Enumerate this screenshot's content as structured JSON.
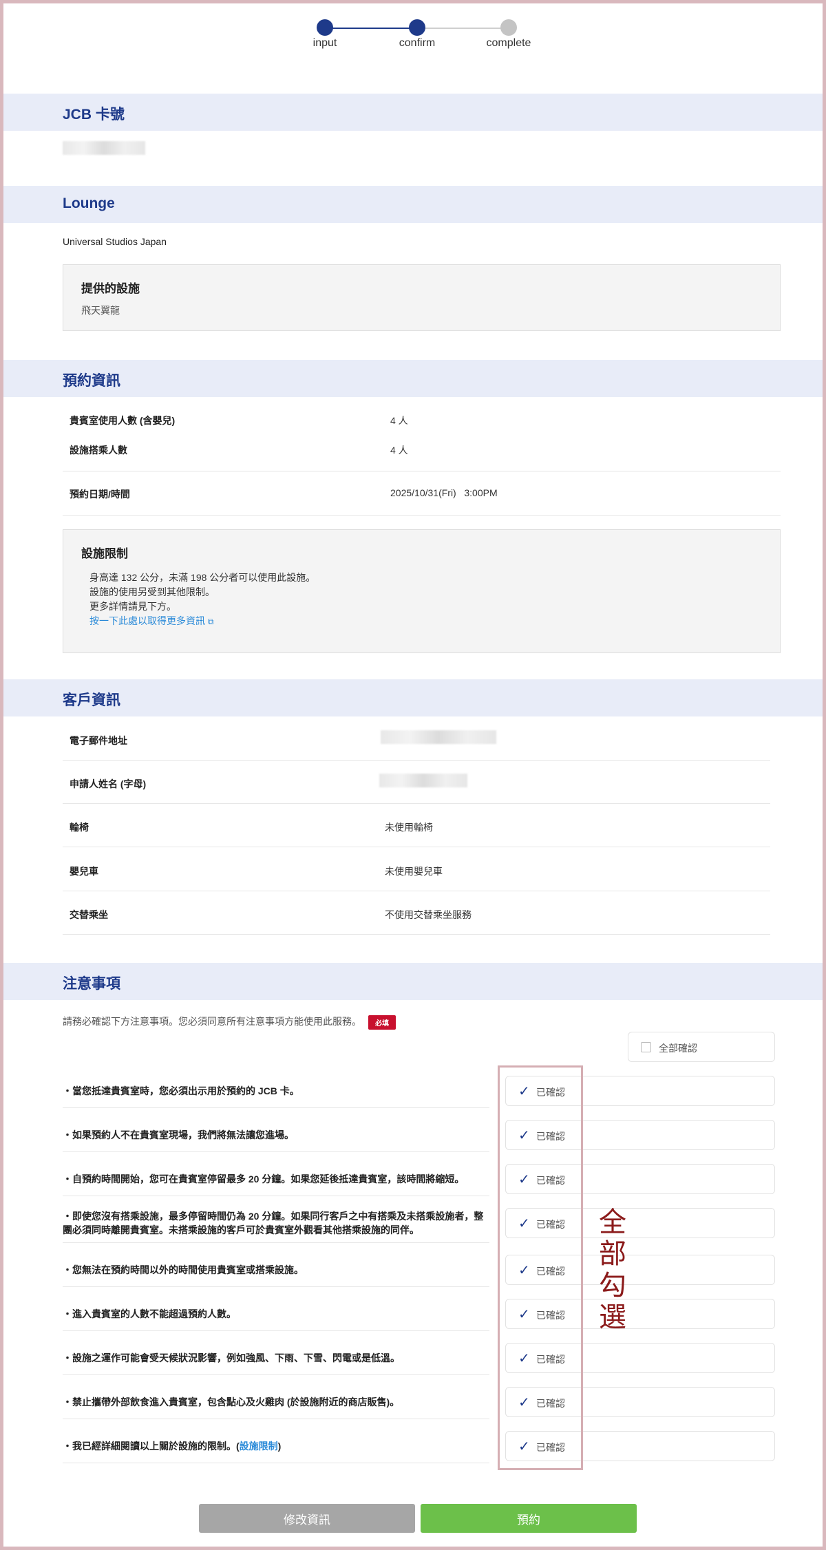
{
  "steps": [
    {
      "label": "input"
    },
    {
      "label": "confirm"
    },
    {
      "label": "complete"
    }
  ],
  "card": {
    "title": "JCB 卡號"
  },
  "lounge": {
    "title": "Lounge",
    "name": "Universal Studios Japan",
    "facility_title": "提供的設施",
    "facility": "飛天翼龍"
  },
  "reservation": {
    "title": "預約資訊",
    "rows": [
      {
        "label": "貴賓室使用人數 (含嬰兒)",
        "value": "4 人"
      },
      {
        "label": "設施搭乘人數",
        "value": "4 人"
      },
      {
        "label": "預約日期/時間",
        "value": "2025/10/31(Fri)   3:00PM"
      }
    ],
    "limit_title": "設施限制",
    "limit_lines": [
      "身高達 132 公分，未滿 198 公分者可以使用此設施。",
      "設施的使用另受到其他限制。",
      "更多詳情請見下方。"
    ],
    "limit_link": "按一下此處以取得更多資訊"
  },
  "customer": {
    "title": "客戶資訊",
    "rows": [
      {
        "label": "電子郵件地址",
        "value": ""
      },
      {
        "label": "申請人姓名 (字母)",
        "value": ""
      },
      {
        "label": "輪椅",
        "value": "未使用輪椅"
      },
      {
        "label": "嬰兒車",
        "value": "未使用嬰兒車"
      },
      {
        "label": "交替乘坐",
        "value": "不使用交替乘坐服務"
      }
    ]
  },
  "notes": {
    "title": "注意事項",
    "intro": "請務必確認下方注意事項。您必須同意所有注意事項方能使用此服務。",
    "required": "必填",
    "confirm_all": "全部確認",
    "confirmed_label": "已確認",
    "items": [
      "・當您抵達貴賓室時，您必須出示用於預約的 JCB 卡。",
      "・如果預約人不在貴賓室現場，我們將無法讓您進場。",
      "・自預約時間開始，您可在貴賓室停留最多 20 分鐘。如果您延後抵達貴賓室，該時間將縮短。",
      "・即使您沒有搭乘設施，最多停留時間仍為 20 分鐘。如果同行客戶之中有搭乘及未搭乘設施者，整團必須同時離開貴賓室。未搭乘設施的客戶可於貴賓室外觀看其他搭乘設施的同伴。",
      "・您無法在預約時間以外的時間使用貴賓室或搭乘設施。",
      "・進入貴賓室的人數不能超過預約人數。",
      "・設施之運作可能會受天候狀況影響，例如強風、下雨、下雪、閃電或是低溫。",
      "・禁止攜帶外部飲食進入貴賓室，包含點心及火雞肉 (於設施附近的商店販售)。"
    ],
    "last_item_prefix": "・我已經詳細閱讀以上關於設施的限制。(",
    "last_item_link": "設施限制",
    "last_item_suffix": ")"
  },
  "annotation": {
    "chars": [
      "全",
      "部",
      "勾",
      "選"
    ]
  },
  "buttons": {
    "modify": "修改資訊",
    "reserve": "預約"
  },
  "colors": {
    "accent": "#1e3a8a",
    "link": "#2a8ad8",
    "reserve": "#6cc04a",
    "modify": "#a6a6a6",
    "required": "#c8102e",
    "annotation": "#8b1a1a"
  }
}
